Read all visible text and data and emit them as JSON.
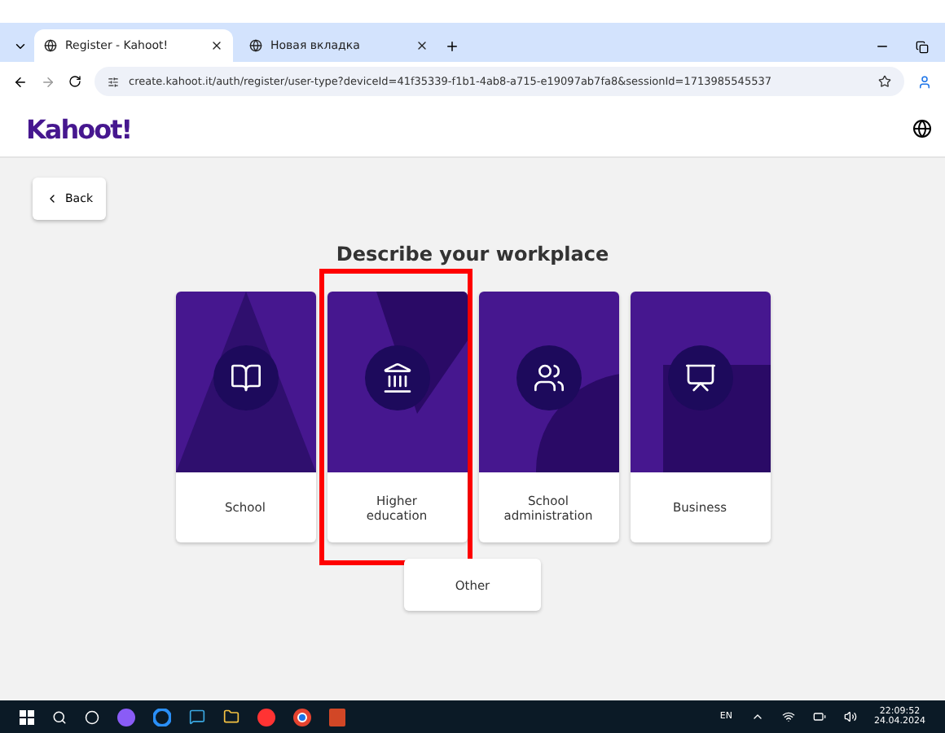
{
  "browser": {
    "tabs": [
      {
        "title": "Register - Kahoot!",
        "selected": true
      },
      {
        "title": "Новая вкладка",
        "selected": false
      }
    ],
    "url": "create.kahoot.it/auth/register/user-type?deviceId=41f35339-f1b1-4ab8-a715-e19097ab7fa8&sessionId=1713985545537"
  },
  "header": {
    "logo": "Kahoot!"
  },
  "back_button": "Back",
  "heading": "Describe your workplace",
  "cards": [
    {
      "kind": "school",
      "label": "School",
      "highlighted": false
    },
    {
      "kind": "higher",
      "label": "Higher education",
      "highlighted": true
    },
    {
      "kind": "admin",
      "label": "School administration",
      "highlighted": false
    },
    {
      "kind": "business",
      "label": "Business",
      "highlighted": false
    }
  ],
  "other_button": "Other",
  "taskbar": {
    "language": "EN",
    "time": "22:09:52",
    "date": "24.04.2024"
  }
}
